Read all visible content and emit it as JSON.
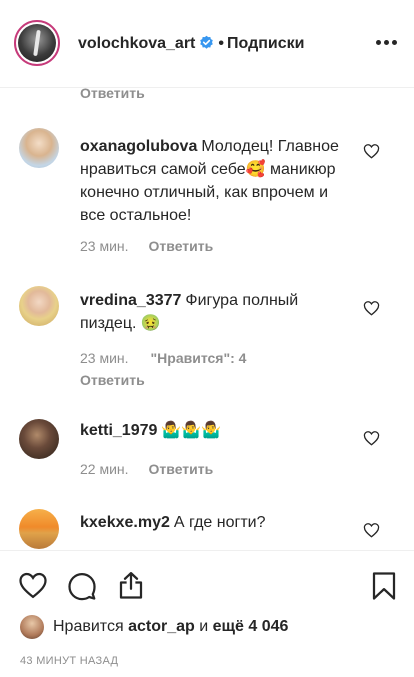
{
  "header": {
    "username": "volochkova_art",
    "dot": "•",
    "follow_label": "Подписки",
    "verified_icon": "verified-badge-icon",
    "more_icon": "more-options-icon"
  },
  "comments": {
    "top_reply_label": "Ответить",
    "items": [
      {
        "username": "oxanagolubova",
        "text": "Молодец! Главное нравиться самой себе🥰 маникюр конечно отличный, как впрочем и все остальное!",
        "time": "23 мин.",
        "reply_label": "Ответить"
      },
      {
        "username": "vredina_3377",
        "text": "Фигура полный пиздец. 🤢",
        "time": "23 мин.",
        "likes_label": "\"Нравится\": 4",
        "reply_label": "Ответить"
      },
      {
        "username": "ketti_1979",
        "text": "🤷‍♂️🤷‍♂️🤷‍♂️",
        "time": "22 мин.",
        "reply_label": "Ответить"
      },
      {
        "username": "kxekxe.my2",
        "text": "А где ногти?"
      }
    ]
  },
  "actions": {
    "icons": [
      "heart-icon",
      "comment-icon",
      "share-icon",
      "bookmark-icon"
    ],
    "liked_by_prefix": "Нравится",
    "liked_by_user": "actor_ap",
    "liked_by_conj": "и",
    "liked_by_more": "ещё 4 046",
    "timestamp": "43 МИНУТ НАЗАД"
  }
}
